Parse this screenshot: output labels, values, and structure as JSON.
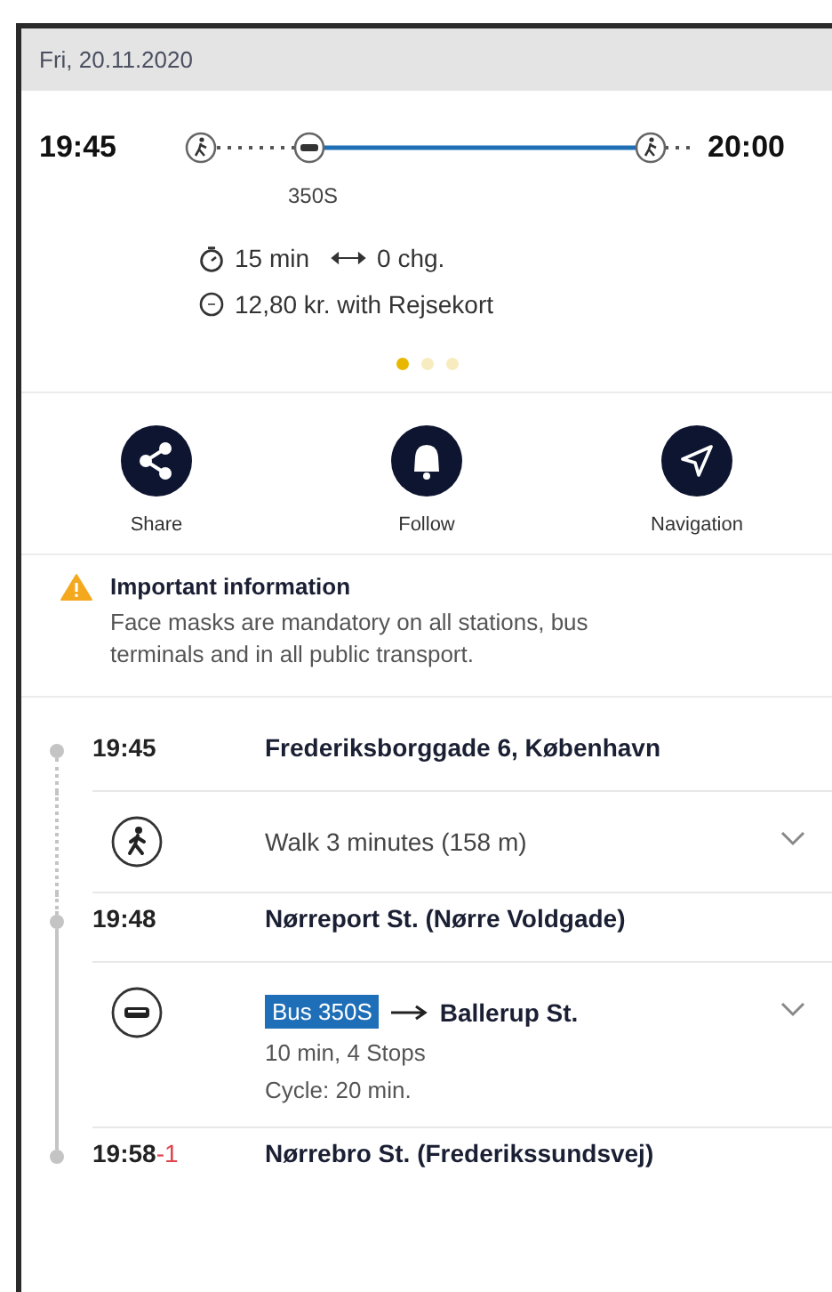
{
  "date": "Fri, 20.11.2020",
  "summary": {
    "departure": "19:45",
    "arrival": "20:00",
    "line_label": "350S",
    "duration": "15 min",
    "changes": "0 chg.",
    "fare": "12,80 kr. with Rejsekort"
  },
  "pager": [
    {
      "selected": true
    },
    {
      "selected": false
    },
    {
      "selected": false
    }
  ],
  "actions": [
    {
      "kind": "share",
      "label": "Share"
    },
    {
      "kind": "follow",
      "label": "Follow"
    },
    {
      "kind": "navigation",
      "label": "Navigation"
    }
  ],
  "notice": {
    "title": "Important information",
    "text": "Face masks are mandatory on all stations, bus terminals and in all public transport."
  },
  "itinerary": [
    {
      "kind": "stop",
      "time": "19:45",
      "name": "Frederiksborggade 6, København"
    },
    {
      "kind": "walk",
      "text": "Walk 3 minutes (158 m)"
    },
    {
      "kind": "stop",
      "time": "19:48",
      "name": "Nørreport St. (Nørre Voldgade)"
    },
    {
      "kind": "bus",
      "badge": "Bus 350S",
      "destination": "Ballerup St.",
      "details": [
        "10 min, 4 Stops",
        "Cycle: 20 min."
      ]
    },
    {
      "kind": "stop",
      "time": "19:58",
      "delay": "-1",
      "name": "Nørrebro St. (Frederikssundsvej)"
    }
  ]
}
